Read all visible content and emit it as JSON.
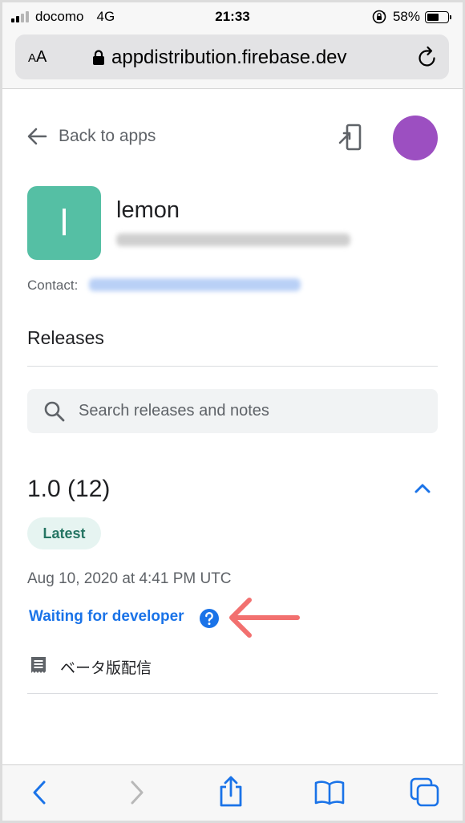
{
  "status_bar": {
    "carrier": "docomo",
    "network": "4G",
    "time": "21:33",
    "battery": "58%",
    "battery_level": 0.58,
    "signal_bars_filled": 2,
    "signal_bars_total": 4
  },
  "browser": {
    "text_size_label": "AA",
    "url": "appdistribution.firebase.dev"
  },
  "page": {
    "back_label": "Back to apps",
    "app": {
      "icon_letter": "l",
      "icon_color": "#55bfa4",
      "name": "lemon",
      "contact_label": "Contact:"
    },
    "releases_heading": "Releases",
    "search_placeholder": "Search releases and notes",
    "release": {
      "version": "1.0 (12)",
      "badge": "Latest",
      "date": "Aug 10, 2020 at 4:41 PM UTC",
      "status": "Waiting for developer",
      "notes": "ベータ版配信"
    }
  },
  "colors": {
    "accent": "#1a73e8",
    "avatar": "#9c4fc1",
    "annotation_arrow": "#f2706f"
  }
}
